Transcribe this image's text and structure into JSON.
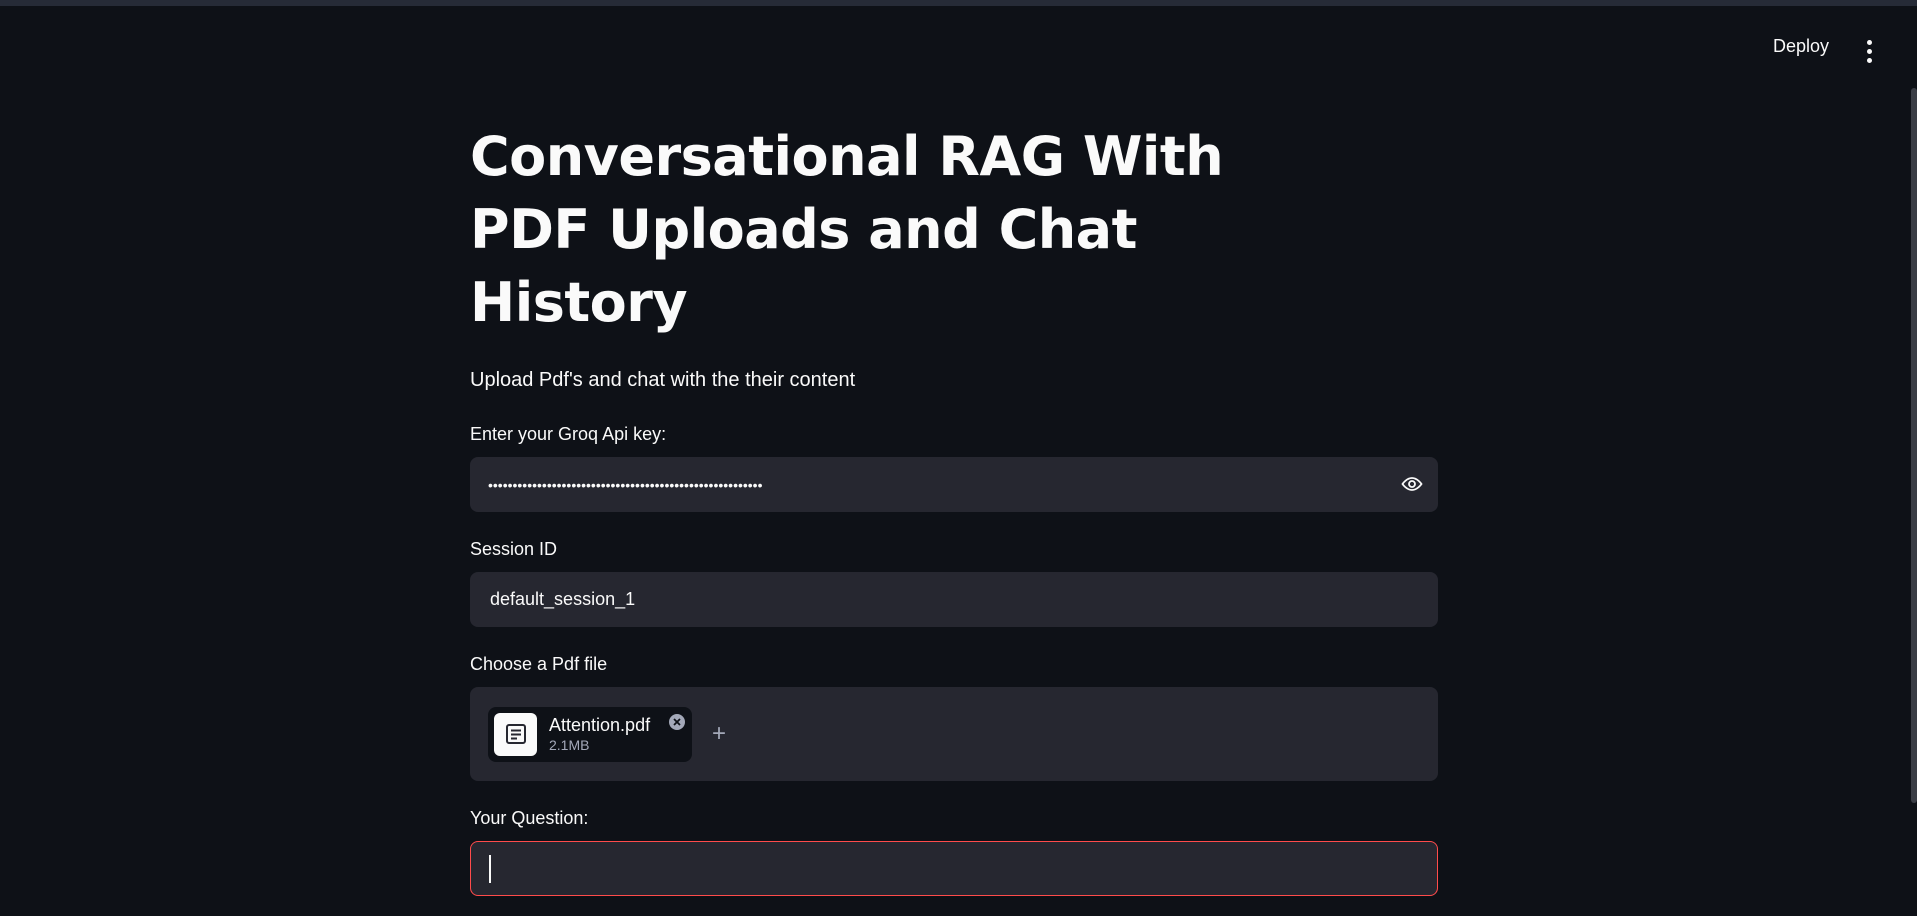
{
  "header": {
    "deploy_label": "Deploy",
    "menu_icon": "vertical-ellipsis-icon"
  },
  "main": {
    "title": "Conversational RAG With PDF Uploads and Chat History",
    "subtitle": "Upload Pdf's and chat with the their content",
    "api_key": {
      "label": "Enter your Groq Api key:",
      "value_masked": "••••••••••••••••••••••••••••••••••••••••••••••••••••••••",
      "toggle_icon": "eye-icon"
    },
    "session": {
      "label": "Session ID",
      "value": "default_session_1"
    },
    "upload": {
      "label": "Choose a Pdf file",
      "file_name": "Attention.pdf",
      "file_size": "2.1MB",
      "file_icon": "document-icon",
      "remove_icon": "close-circle-icon",
      "add_label": "+"
    },
    "question": {
      "label": "Your Question:",
      "value": ""
    }
  },
  "colors": {
    "background": "#0e1117",
    "input_bg": "#262730",
    "focus_border": "#ff4b4b",
    "text": "#fafafa"
  }
}
